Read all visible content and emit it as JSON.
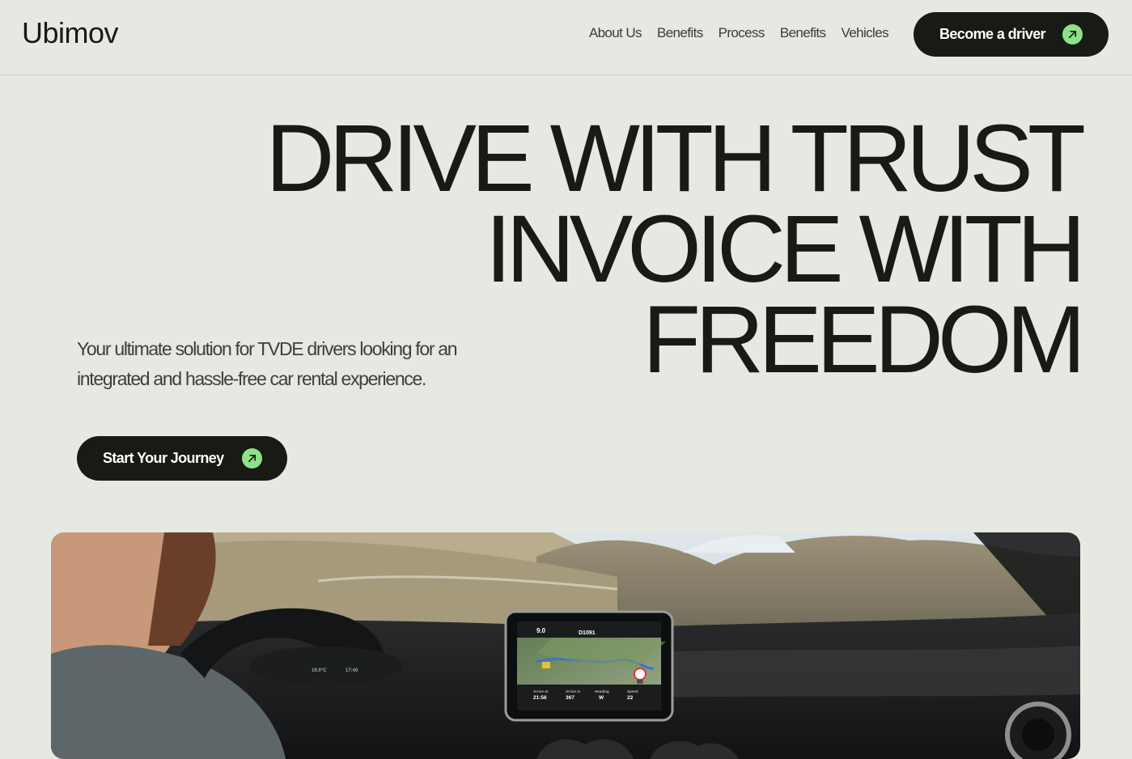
{
  "brand": {
    "logo": "Ubimov"
  },
  "nav": {
    "items": [
      {
        "label": "About Us"
      },
      {
        "label": "Benefits"
      },
      {
        "label": "Process"
      },
      {
        "label": "Benefits"
      },
      {
        "label": "Vehicles"
      }
    ],
    "cta_label": "Become a driver"
  },
  "hero": {
    "headline_line1": "DRIVE WITH TRUST",
    "headline_line2": "INVOICE WITH FREEDOM",
    "subtitle": "Your ultimate solution for TVDE drivers looking for an integrated and hassle-free car rental experience.",
    "cta_label": "Start Your Journey"
  },
  "photo": {
    "gps": {
      "distance": "9.0",
      "road": "D1091",
      "speed_limit": "90",
      "stats": [
        {
          "label": "Arrive at",
          "value": "21:56"
        },
        {
          "label": "Arrive in",
          "value": "367"
        },
        {
          "label": "Heading",
          "value": "W"
        },
        {
          "label": "Speed",
          "value": "22"
        }
      ]
    },
    "cluster": {
      "temp": "19.0°C",
      "time": "17:40"
    }
  },
  "colors": {
    "background": "#e6e8e2",
    "dark": "#181a15",
    "accent": "#8fe08a"
  }
}
